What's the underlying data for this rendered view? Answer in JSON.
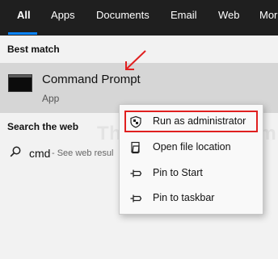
{
  "tabs": [
    {
      "label": "All",
      "active": true
    },
    {
      "label": "Apps"
    },
    {
      "label": "Documents"
    },
    {
      "label": "Email"
    },
    {
      "label": "Web"
    },
    {
      "label": "Mor"
    }
  ],
  "best_match": {
    "heading": "Best match",
    "item": {
      "title": "Command Prompt",
      "subtitle": "App",
      "icon": "command-prompt-icon"
    }
  },
  "search_web": {
    "heading": "Search the web",
    "query": "cmd",
    "description": "- See web resul"
  },
  "context_menu": {
    "items": [
      {
        "label": "Run as administrator",
        "icon": "shield-icon",
        "highlighted": true
      },
      {
        "label": "Open file location",
        "icon": "folder-file-icon"
      },
      {
        "label": "Pin to Start",
        "icon": "pin-icon"
      },
      {
        "label": "Pin to taskbar",
        "icon": "pin-icon"
      }
    ]
  },
  "watermark": "TheGeekPage.com",
  "colors": {
    "tabbar_bg": "#1f1f1f",
    "accent": "#0a84ff",
    "annotation": "#e02020",
    "selected_bg": "#d6d6d6"
  }
}
